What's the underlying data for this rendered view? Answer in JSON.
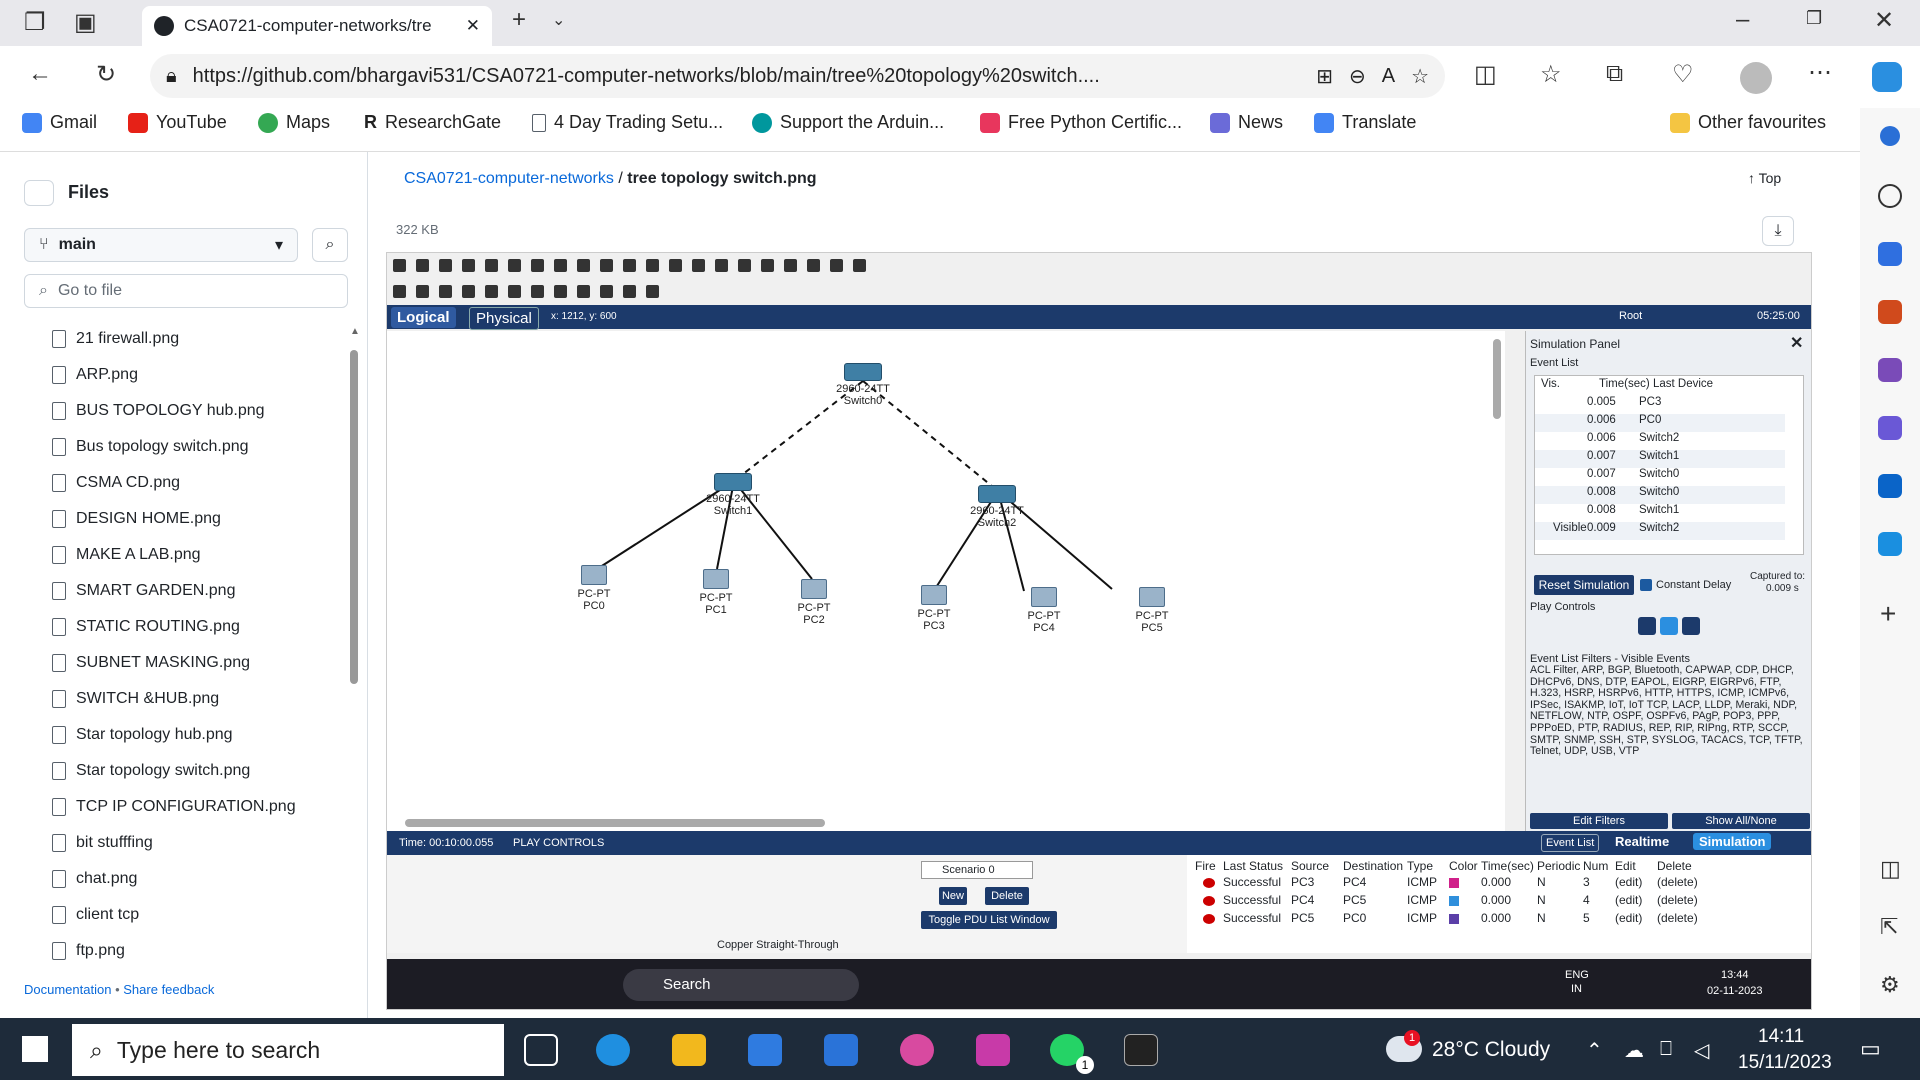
{
  "browser": {
    "tab_title": "CSA0721-computer-networks/tre",
    "url": "https://github.com/bhargavi531/CSA0721-computer-networks/blob/main/tree%20topology%20switch....",
    "bookmarks": [
      "Gmail",
      "YouTube",
      "Maps",
      "ResearchGate",
      "4 Day Trading Setu...",
      "Support the Arduin...",
      "Free Python Certific...",
      "News",
      "Translate"
    ],
    "other_favourites": "Other favourites"
  },
  "sidebar": {
    "title": "Files",
    "branch": "main",
    "goto_placeholder": "Go to file",
    "files": [
      "21 firewall.png",
      "ARP.png",
      "BUS TOPOLOGY hub.png",
      "Bus topology switch.png",
      "CSMA CD.png",
      "DESIGN HOME.png",
      "MAKE A LAB.png",
      "SMART GARDEN.png",
      "STATIC ROUTING.png",
      "SUBNET MASKING.png",
      "SWITCH &HUB.png",
      "Star topology hub.png",
      "Star topology switch.png",
      "TCP IP CONFIGURATION.png",
      "bit stufffing",
      "chat.png",
      "client tcp",
      "ftp.png"
    ],
    "footer_doc": "Documentation",
    "footer_sep": "•",
    "footer_feedback": "Share feedback"
  },
  "main": {
    "repo": "CSA0721-computer-networks",
    "sep": "/",
    "file": "tree topology switch.png",
    "top": "Top",
    "size": "322 KB"
  },
  "pt": {
    "tab_logical": "Logical",
    "tab_physical": "Physical",
    "coords": "x: 1212, y: 600",
    "root": "Root",
    "clock": "05:25:00",
    "nodes": [
      {
        "type": "2960-24TT",
        "name": "Switch0"
      },
      {
        "type": "2960-24TT",
        "name": "Switch1"
      },
      {
        "type": "2960-24TT",
        "name": "Switch2"
      },
      {
        "type": "PC-PT",
        "name": "PC0"
      },
      {
        "type": "PC-PT",
        "name": "PC1"
      },
      {
        "type": "PC-PT",
        "name": "PC2"
      },
      {
        "type": "PC-PT",
        "name": "PC3"
      },
      {
        "type": "PC-PT",
        "name": "PC4"
      },
      {
        "type": "PC-PT",
        "name": "PC5"
      }
    ],
    "sim": {
      "title": "Simulation Panel",
      "event_list": "Event List",
      "headers": [
        "Vis.",
        "Time(sec)",
        "Last Device"
      ],
      "events": [
        {
          "vis": "",
          "time": "0.005",
          "dev": "PC3"
        },
        {
          "vis": "",
          "time": "0.006",
          "dev": "PC0"
        },
        {
          "vis": "",
          "time": "0.006",
          "dev": "Switch2"
        },
        {
          "vis": "",
          "time": "0.007",
          "dev": "Switch1"
        },
        {
          "vis": "",
          "time": "0.007",
          "dev": "Switch0"
        },
        {
          "vis": "",
          "time": "0.008",
          "dev": "Switch0"
        },
        {
          "vis": "",
          "time": "0.008",
          "dev": "Switch1"
        },
        {
          "vis": "Visible",
          "time": "0.009",
          "dev": "Switch2"
        }
      ],
      "reset": "Reset Simulation",
      "constant_delay": "Constant Delay",
      "captured": "Captured to:",
      "captured_val": "0.009 s",
      "play_controls": "Play Controls",
      "filters_title": "Event List Filters - Visible Events",
      "filters": "ACL Filter, ARP, BGP, Bluetooth, CAPWAP, CDP, DHCP, DHCPv6, DNS, DTP, EAPOL, EIGRP, EIGRPv6, FTP, H.323, HSRP, HSRPv6, HTTP, HTTPS, ICMP, ICMPv6, IPSec, ISAKMP, IoT, IoT TCP, LACP, LLDP, Meraki, NDP, NETFLOW, NTP, OSPF, OSPFv6, PAgP, POP3, PPP, PPPoED, PTP, RADIUS, REP, RIP, RIPng, RTP, SCCP, SMTP, SNMP, SSH, STP, SYSLOG, TACACS, TCP, TFTP, Telnet, UDP, USB, VTP",
      "edit_filters": "Edit Filters",
      "show_all": "Show All/None"
    },
    "time": "Time: 00:10:00.055",
    "play_label": "PLAY CONTROLS",
    "mode_event": "Event List",
    "mode_realtime": "Realtime",
    "mode_sim": "Simulation",
    "cable": "Copper Straight-Through",
    "scenario": "Scenario 0",
    "new": "New",
    "delete": "Delete",
    "toggle_pdu": "Toggle PDU List Window",
    "pdu_headers": [
      "Fire",
      "Last Status",
      "Source",
      "Destination",
      "Type",
      "Color",
      "Time(sec)",
      "Periodic",
      "Num",
      "Edit",
      "Delete"
    ],
    "pdus": [
      {
        "status": "Successful",
        "src": "PC3",
        "dst": "PC4",
        "type": "ICMP",
        "color": "#d0208a",
        "time": "0.000",
        "periodic": "N",
        "num": "3",
        "edit": "(edit)",
        "del": "(delete)"
      },
      {
        "status": "Successful",
        "src": "PC4",
        "dst": "PC5",
        "type": "ICMP",
        "color": "#2f8fdc",
        "time": "0.000",
        "periodic": "N",
        "num": "4",
        "edit": "(edit)",
        "del": "(delete)"
      },
      {
        "status": "Successful",
        "src": "PC5",
        "dst": "PC0",
        "type": "ICMP",
        "color": "#5b3fa8",
        "time": "0.000",
        "periodic": "N",
        "num": "5",
        "edit": "(edit)",
        "del": "(delete)"
      }
    ],
    "inner_taskbar": {
      "search": "Search",
      "lang1": "ENG",
      "lang2": "IN",
      "time": "13:44",
      "date": "02-11-2023"
    }
  },
  "taskbar": {
    "search_placeholder": "Type here to search",
    "weather": "28°C  Cloudy",
    "time": "14:11",
    "date": "15/11/2023",
    "notif": "1",
    "wa_badge": "1"
  }
}
